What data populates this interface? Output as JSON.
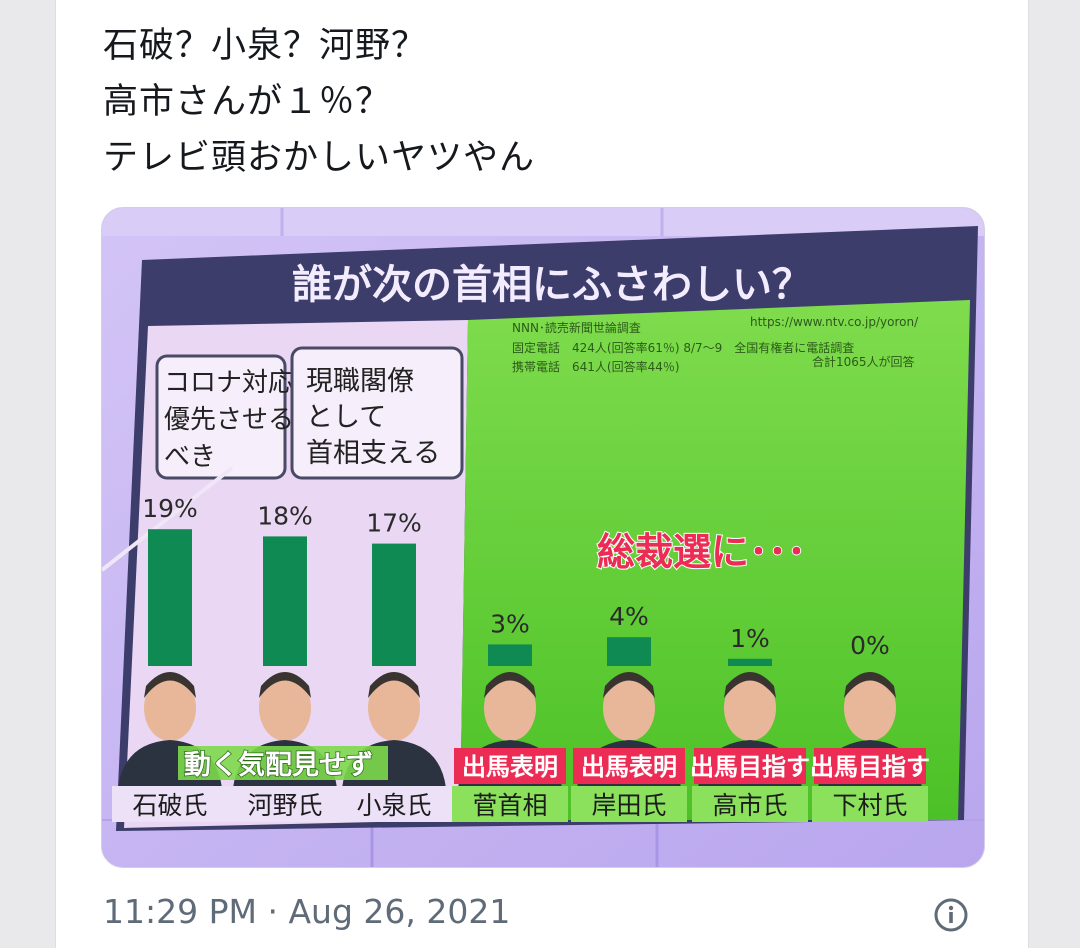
{
  "tweet": {
    "lines": [
      "石破？小泉？河野？",
      "高市さんが１％？",
      "テレビ頭おかしいヤツやん"
    ],
    "time": "11:29 PM",
    "separator": "·",
    "date": "Aug 26, 2021",
    "info_icon": "info-circle-icon"
  },
  "media": {
    "panel_title": "誰が次の首相にふさわしい？",
    "source_line1": "NNN･読売新聞世論調査",
    "source_url": "https://www.ntv.co.jp/yoron/",
    "source_line2": "固定電話　424人(回答率61％) 8/7～9　全国有権者に電話調査",
    "source_line3": "携帯電話　641人(回答率44％)",
    "source_total": "合計1065人が回答",
    "label_box1": [
      "コロナ対応",
      "優先させる",
      "べき"
    ],
    "label_box2": [
      "現職閣僚",
      "として",
      "首相支える"
    ],
    "candidacy_banner": "総裁選に･･･",
    "colors": {
      "bar": "#0e8a52",
      "left_panel": "#e9d7f3",
      "right_panel": "#6ed43a",
      "tag_red": "#ec2c55"
    }
  },
  "chart_data": {
    "type": "bar",
    "title": "誰が次の首相にふさわしい？",
    "categories": [
      "石破氏",
      "河野氏",
      "小泉氏",
      "菅首相",
      "岸田氏",
      "高市氏",
      "下村氏"
    ],
    "values": [
      19,
      18,
      17,
      3,
      4,
      1,
      0
    ],
    "value_labels": [
      "19%",
      "18%",
      "17%",
      "3%",
      "4%",
      "1%",
      "0%"
    ],
    "status_tags": [
      "",
      "",
      "",
      "出馬表明",
      "出馬表明",
      "出馬目指す",
      "出馬目指す"
    ],
    "group_tag": "動く気配見せず"
  }
}
